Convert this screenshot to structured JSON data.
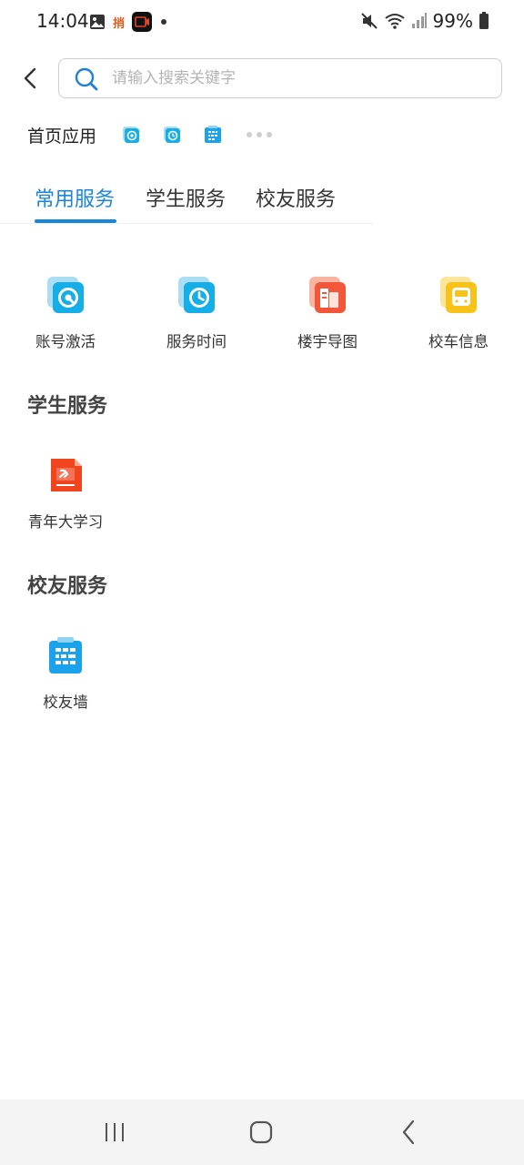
{
  "status_bar": {
    "time": "14:04",
    "battery": "99%",
    "notification_badge": "捎",
    "icons": [
      "gallery-icon",
      "app-notification-icon",
      "screen-recorder-icon",
      "dot-icon",
      "mute-icon",
      "wifi-icon",
      "signal-icon",
      "battery-icon"
    ]
  },
  "search": {
    "placeholder": "请输入搜索关键字",
    "value": ""
  },
  "home_apps": {
    "label": "首页应用",
    "icons": [
      "account-activation-icon",
      "service-time-icon",
      "alumni-wall-icon"
    ]
  },
  "tabs": [
    {
      "label": "常用服务",
      "active": true
    },
    {
      "label": "学生服务",
      "active": false
    },
    {
      "label": "校友服务",
      "active": false
    }
  ],
  "common_services": [
    {
      "label": "账号激活",
      "icon": "account-activation-icon",
      "color": "#16aee6"
    },
    {
      "label": "服务时间",
      "icon": "service-time-icon",
      "color": "#16aee6"
    },
    {
      "label": "楼宇导图",
      "icon": "building-map-icon",
      "color": "#f2573a"
    },
    {
      "label": "校车信息",
      "icon": "school-bus-icon",
      "color": "#f7c21a"
    }
  ],
  "student_services": {
    "title": "学生服务",
    "items": [
      {
        "label": "青年大学习",
        "icon": "youth-study-icon",
        "color": "#f1451f"
      }
    ]
  },
  "alumni_services": {
    "title": "校友服务",
    "items": [
      {
        "label": "校友墙",
        "icon": "alumni-wall-icon",
        "color": "#1aa3ea"
      }
    ]
  },
  "colors": {
    "accent": "#1a86d9"
  }
}
